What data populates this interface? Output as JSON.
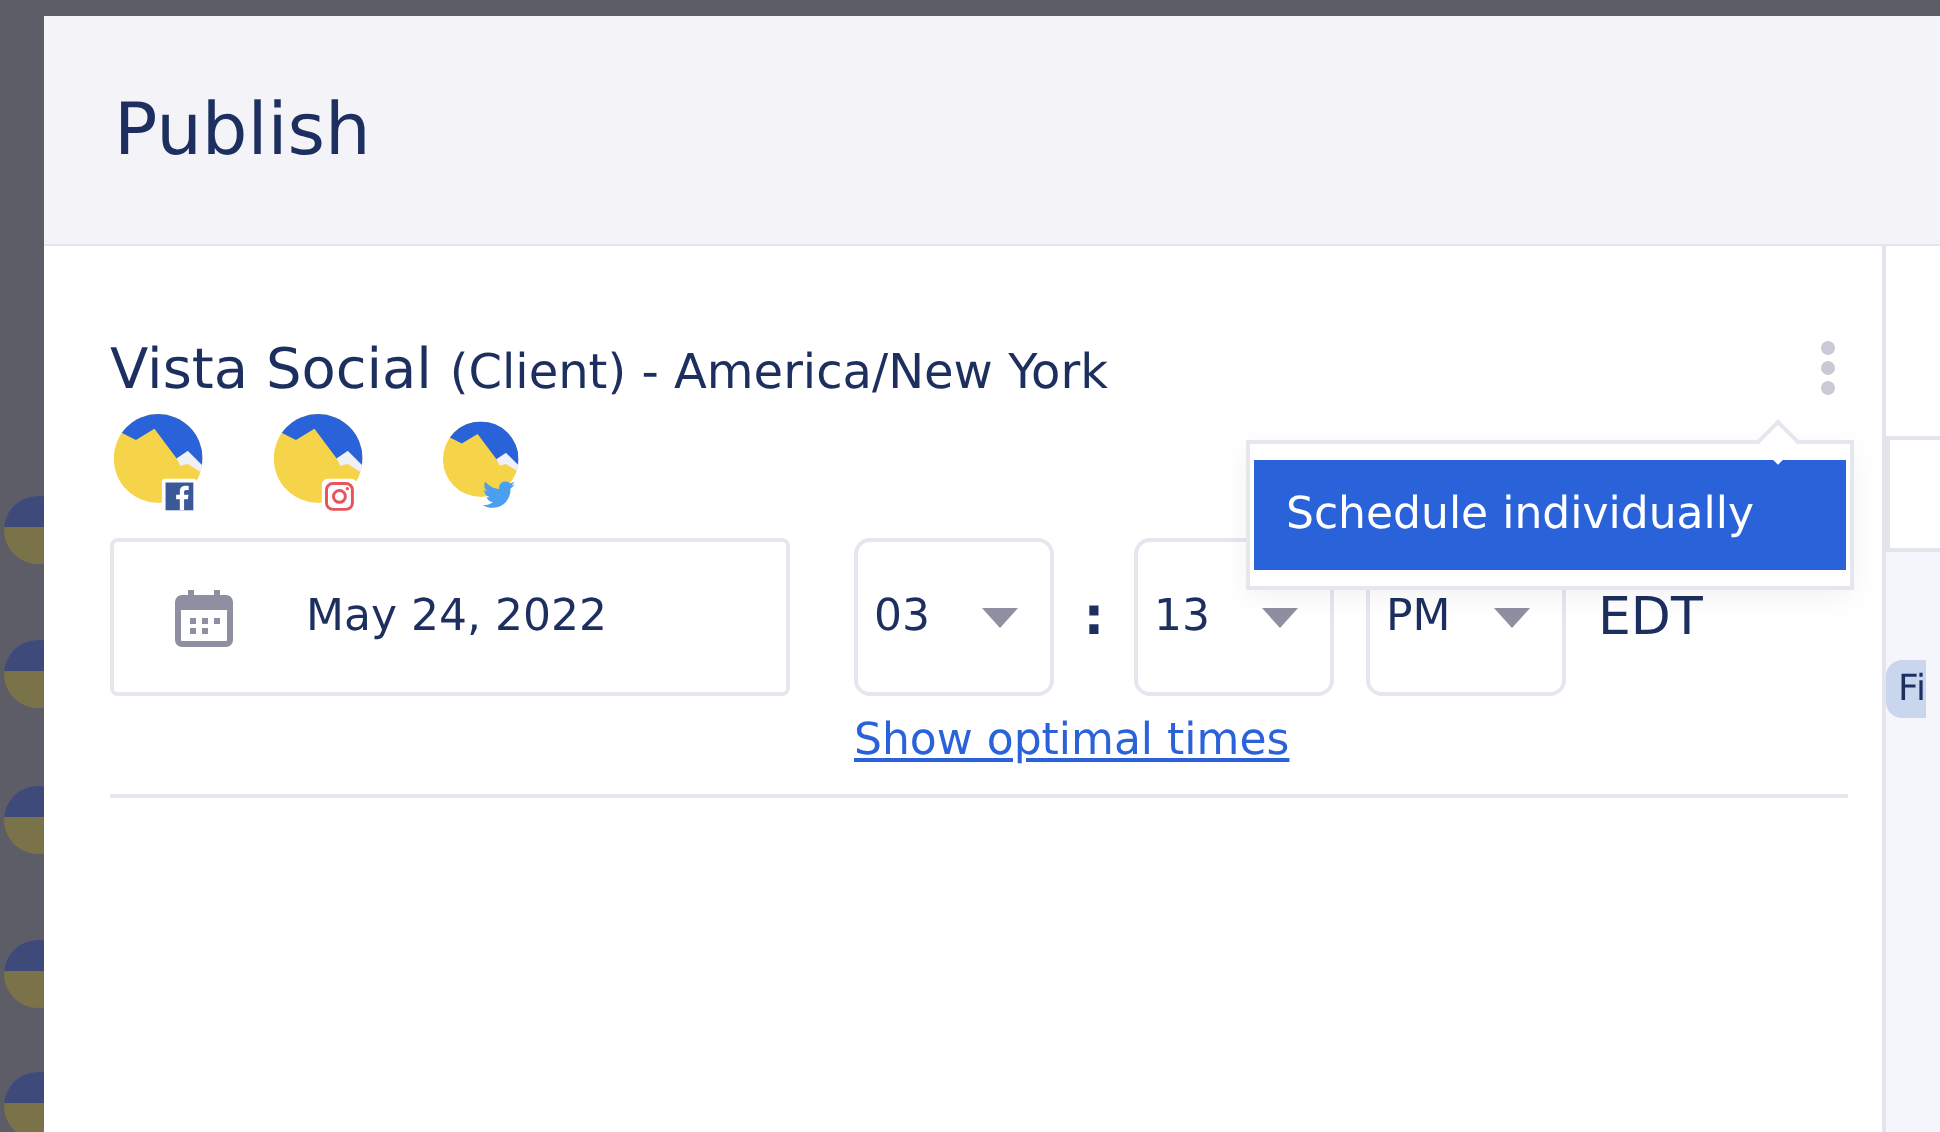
{
  "modal": {
    "title": "Publish",
    "profile_group": {
      "name": "Vista Social",
      "suffix": "(Client) - America/New York",
      "profiles": [
        {
          "kind": "facebook"
        },
        {
          "kind": "instagram"
        },
        {
          "kind": "twitter"
        }
      ],
      "date": "May 24, 2022",
      "hour": "03",
      "separator": ":",
      "minute": "13",
      "period": "PM",
      "timezone": "EDT",
      "optimal_link": "Show optimal times",
      "menu": {
        "items": [
          {
            "label": "Schedule individually",
            "selected": true
          }
        ]
      }
    },
    "side_panel": {
      "chip": "Fi"
    }
  }
}
